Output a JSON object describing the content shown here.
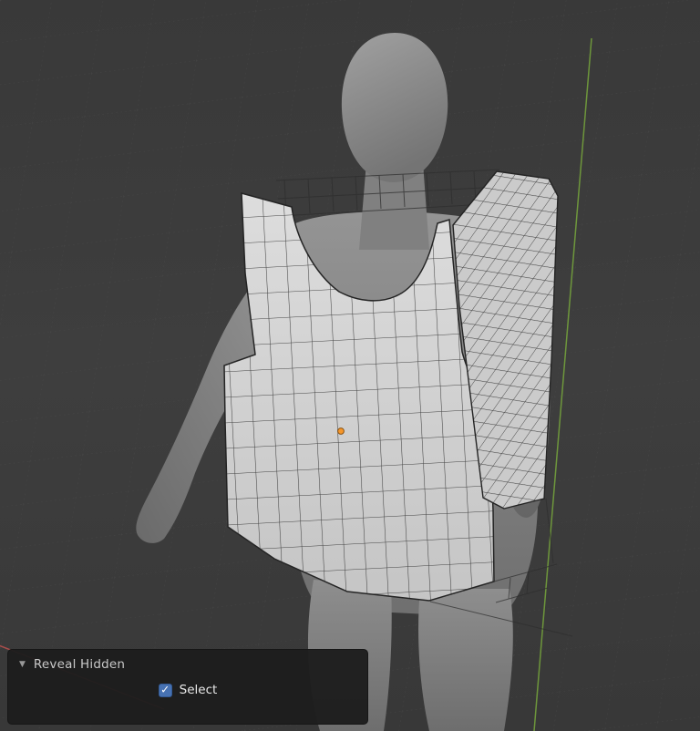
{
  "operator_panel": {
    "title": "Reveal Hidden",
    "collapse_icon": "▼",
    "options": [
      {
        "label": "Select",
        "checked": true
      }
    ]
  },
  "icons": {
    "checkmark": "✓"
  },
  "colors": {
    "accent_blue": "#4772b3",
    "viewport_bg": "#3b3b3b",
    "axis_green": "#77a73c",
    "axis_red": "#b5504d",
    "origin_orange": "#f5962a",
    "mesh_face": "#d5d5d5",
    "mesh_edge": "#2b2b2b",
    "body_gray": "#8d8d8d"
  }
}
